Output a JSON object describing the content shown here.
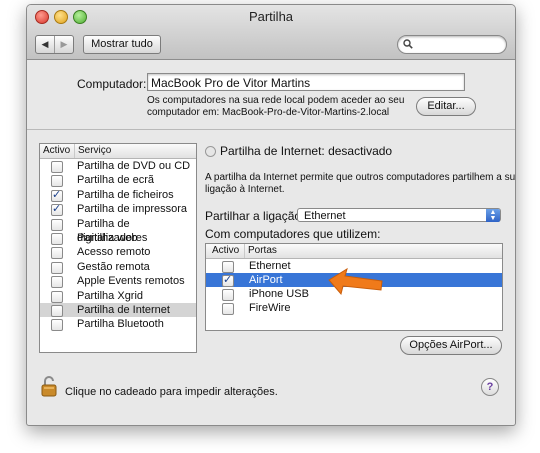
{
  "window": {
    "title": "Partilha"
  },
  "toolbar": {
    "back": "◀",
    "forward": "▶",
    "show_all": "Mostrar tudo",
    "search_value": ""
  },
  "computer": {
    "label": "Computador:",
    "name": "MacBook Pro de Vitor Martins",
    "note_line1": "Os computadores na sua rede local podem aceder ao seu",
    "note_line2": "computador em: MacBook-Pro-de-Vitor-Martins-2.local",
    "edit_button": "Editar..."
  },
  "services": {
    "headers": {
      "active": "Activo",
      "service": "Serviço"
    },
    "items": [
      {
        "label": "Partilha de DVD ou CD",
        "checked": false,
        "selected": false
      },
      {
        "label": "Partilha de ecrã",
        "checked": false,
        "selected": false
      },
      {
        "label": "Partilha de ficheiros",
        "checked": true,
        "selected": false
      },
      {
        "label": "Partilha de impressora",
        "checked": true,
        "selected": false
      },
      {
        "label": "Partilha de digitalizadores",
        "checked": false,
        "selected": false
      },
      {
        "label": "Partilha web",
        "checked": false,
        "selected": false
      },
      {
        "label": "Acesso remoto",
        "checked": false,
        "selected": false
      },
      {
        "label": "Gestão remota",
        "checked": false,
        "selected": false
      },
      {
        "label": "Apple Events remotos",
        "checked": false,
        "selected": false
      },
      {
        "label": "Partilha Xgrid",
        "checked": false,
        "selected": false
      },
      {
        "label": "Partilha de Internet",
        "checked": false,
        "selected": true
      },
      {
        "label": "Partilha Bluetooth",
        "checked": false,
        "selected": false
      }
    ]
  },
  "detail": {
    "status": "Partilha de Internet: desactivado",
    "description_line1": "A partilha da Internet permite que outros computadores partilhem a sua",
    "description_line2": "ligação à Internet.",
    "share_from_label": "Partilhar a ligação:",
    "share_from_value": "Ethernet",
    "to_computers_label": "Com computadores que utilizem:",
    "ports_headers": {
      "active": "Activo",
      "ports": "Portas"
    },
    "ports": [
      {
        "label": "Ethernet",
        "checked": false,
        "selected": false
      },
      {
        "label": "AirPort",
        "checked": true,
        "selected": true
      },
      {
        "label": "iPhone USB",
        "checked": false,
        "selected": false
      },
      {
        "label": "FireWire",
        "checked": false,
        "selected": false
      }
    ],
    "airport_options_button": "Opções AirPort..."
  },
  "footer": {
    "lock_text": "Clique no cadeado para impedir alterações.",
    "help": "?"
  },
  "colors": {
    "selection": "#3875d7",
    "arrow": "#f07a1a"
  }
}
